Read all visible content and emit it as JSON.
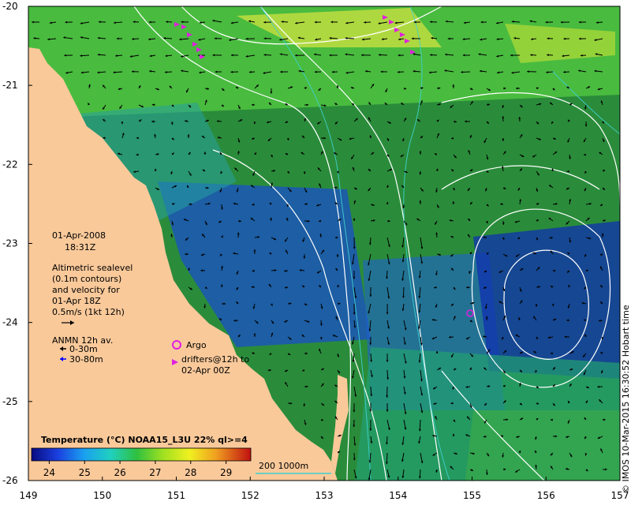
{
  "map": {
    "lat_labels": [
      "-20",
      "-21",
      "-22",
      "-23",
      "-24",
      "-25",
      "-26"
    ],
    "lon_labels": [
      "149",
      "150",
      "151",
      "152",
      "153",
      "154",
      "155",
      "156",
      "157"
    ],
    "extent": {
      "lon_min": 149,
      "lon_max": 157,
      "lat_min": -26,
      "lat_max": -20
    }
  },
  "info": {
    "date": "01-Apr-2008",
    "time": "18:31Z",
    "altimetry_lines": [
      "Altimetric sealevel",
      "(0.1m contours)",
      "and velocity for",
      "01-Apr 18Z"
    ],
    "scale_label": "0.5m/s (1kt 12h)",
    "anmn_title": "ANMN 12h av.",
    "anmn_items": [
      {
        "label": "0-30m",
        "color": "#000000"
      },
      {
        "label": "30-80m",
        "color": "#0000ff"
      }
    ],
    "argo_label": "Argo",
    "drifter_lines": [
      "drifters@12h to",
      "02-Apr 00Z"
    ],
    "argo_color": "#e020e0",
    "drifter_color": "#e020e0"
  },
  "colorbar": {
    "title": "Temperature (°C) NOAA15_L3U 22% ql>=4",
    "ticks": [
      "24",
      "25",
      "26",
      "27",
      "28",
      "29"
    ],
    "tick_values": [
      24,
      25,
      26,
      27,
      28,
      29
    ],
    "range": [
      23.5,
      29.7
    ]
  },
  "bathymetry_legend": {
    "label": "200  1000m",
    "color": "#40d0d0"
  },
  "credit": "© IMOS 10-Mar-2015 16:30:52 Hobart time",
  "colors": {
    "land": "#f9c99a",
    "contour": "#ffffff",
    "arrow": "#000000"
  }
}
